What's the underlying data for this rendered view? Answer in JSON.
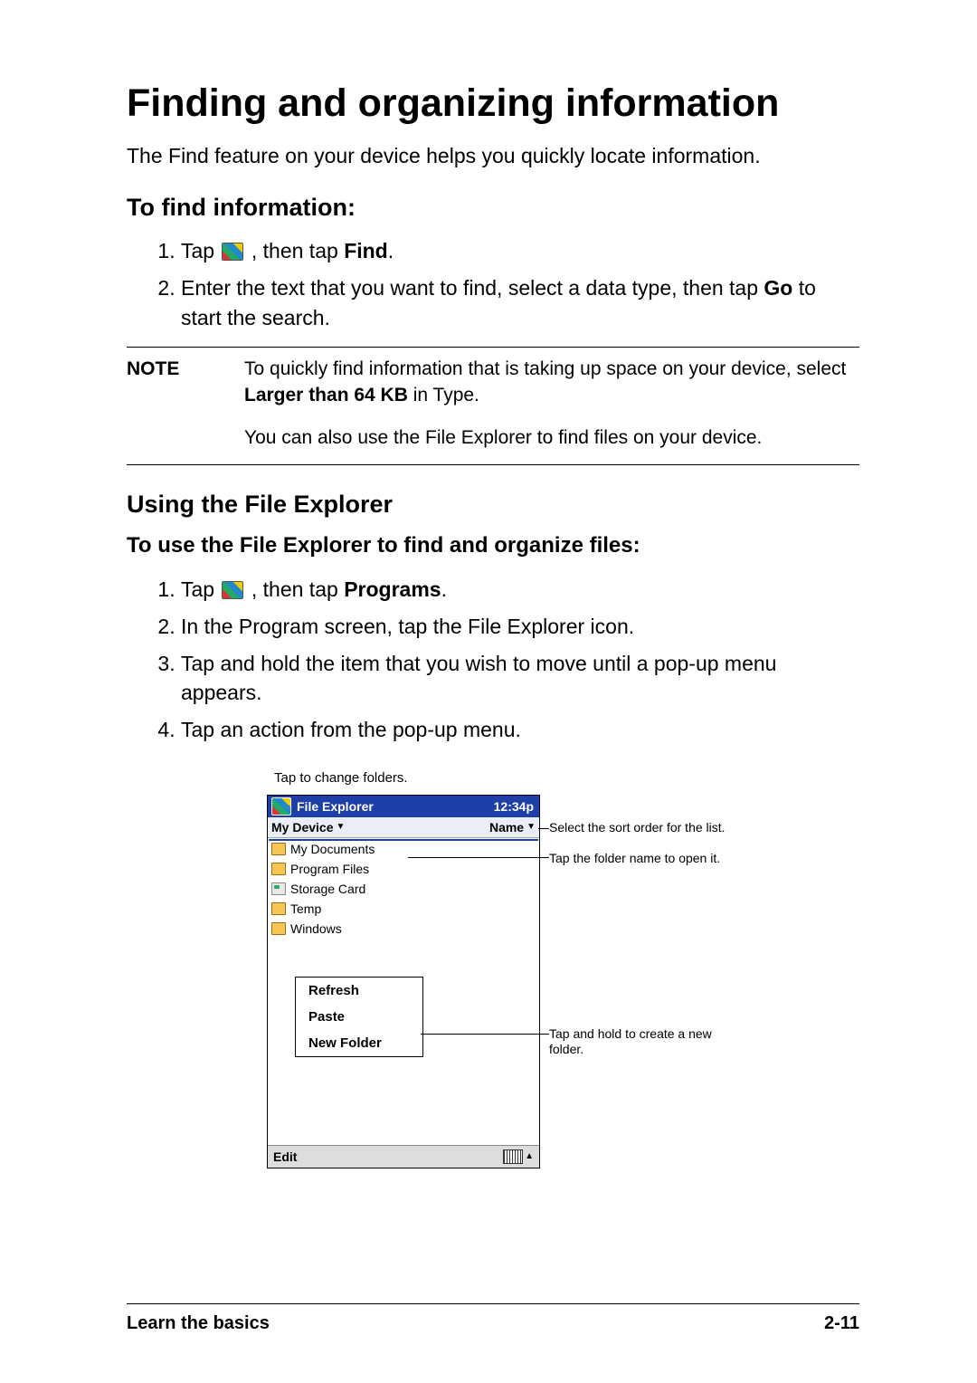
{
  "title": "Finding and organizing information",
  "intro": "The Find feature on your device helps you quickly locate information.",
  "section_find": {
    "heading": "To find information:",
    "steps": {
      "1a": "Tap ",
      "1b": " , then tap ",
      "1c": "Find",
      "1d": ".",
      "2a": "Enter the text that you want to find, select a data type, then tap ",
      "2b": "Go",
      "2c": " to start the search."
    }
  },
  "note": {
    "label": "NOTE",
    "line1a": "To quickly find information that is taking up space on your device, select ",
    "line1b": "Larger than 64 KB",
    "line1c": " in Type.",
    "line2": "You can also use the File Explorer to find files on your device."
  },
  "section_explorer": {
    "heading": "Using the File Explorer",
    "sub": "To use the File Explorer to find and organize files:",
    "steps": {
      "1a": "Tap ",
      "1b": " , then tap ",
      "1c": "Programs",
      "1d": ".",
      "2": "In the Program screen, tap the File Explorer icon.",
      "3": "Tap and hold the item that you wish to move until a pop-up menu appears.",
      "4": "Tap an action from the pop-up menu."
    }
  },
  "figure": {
    "caption_top": "Tap to change folders.",
    "titlebar": {
      "title": "File Explorer",
      "time": "12:34p"
    },
    "nav": {
      "location": "My Device",
      "sort": "Name"
    },
    "folders": [
      "My Documents",
      "Program Files",
      "Storage Card",
      "Temp",
      "Windows"
    ],
    "popup": [
      "Refresh",
      "Paste",
      "New Folder"
    ],
    "editbar": "Edit",
    "callouts": {
      "sort": "Select the sort order for the list.",
      "open": "Tap the folder name to open it.",
      "newfolder": "Tap and hold to create a new folder."
    }
  },
  "footer": {
    "left": "Learn the basics",
    "right": "2-11"
  }
}
